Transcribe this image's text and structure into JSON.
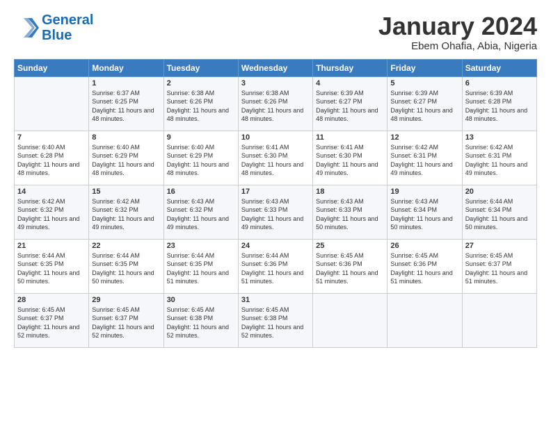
{
  "header": {
    "logo_line1": "General",
    "logo_line2": "Blue",
    "month_title": "January 2024",
    "location": "Ebem Ohafia, Abia, Nigeria"
  },
  "weekdays": [
    "Sunday",
    "Monday",
    "Tuesday",
    "Wednesday",
    "Thursday",
    "Friday",
    "Saturday"
  ],
  "weeks": [
    [
      {
        "day": "",
        "sunrise": "",
        "sunset": "",
        "daylight": ""
      },
      {
        "day": "1",
        "sunrise": "Sunrise: 6:37 AM",
        "sunset": "Sunset: 6:25 PM",
        "daylight": "Daylight: 11 hours and 48 minutes."
      },
      {
        "day": "2",
        "sunrise": "Sunrise: 6:38 AM",
        "sunset": "Sunset: 6:26 PM",
        "daylight": "Daylight: 11 hours and 48 minutes."
      },
      {
        "day": "3",
        "sunrise": "Sunrise: 6:38 AM",
        "sunset": "Sunset: 6:26 PM",
        "daylight": "Daylight: 11 hours and 48 minutes."
      },
      {
        "day": "4",
        "sunrise": "Sunrise: 6:39 AM",
        "sunset": "Sunset: 6:27 PM",
        "daylight": "Daylight: 11 hours and 48 minutes."
      },
      {
        "day": "5",
        "sunrise": "Sunrise: 6:39 AM",
        "sunset": "Sunset: 6:27 PM",
        "daylight": "Daylight: 11 hours and 48 minutes."
      },
      {
        "day": "6",
        "sunrise": "Sunrise: 6:39 AM",
        "sunset": "Sunset: 6:28 PM",
        "daylight": "Daylight: 11 hours and 48 minutes."
      }
    ],
    [
      {
        "day": "7",
        "sunrise": "Sunrise: 6:40 AM",
        "sunset": "Sunset: 6:28 PM",
        "daylight": "Daylight: 11 hours and 48 minutes."
      },
      {
        "day": "8",
        "sunrise": "Sunrise: 6:40 AM",
        "sunset": "Sunset: 6:29 PM",
        "daylight": "Daylight: 11 hours and 48 minutes."
      },
      {
        "day": "9",
        "sunrise": "Sunrise: 6:40 AM",
        "sunset": "Sunset: 6:29 PM",
        "daylight": "Daylight: 11 hours and 48 minutes."
      },
      {
        "day": "10",
        "sunrise": "Sunrise: 6:41 AM",
        "sunset": "Sunset: 6:30 PM",
        "daylight": "Daylight: 11 hours and 48 minutes."
      },
      {
        "day": "11",
        "sunrise": "Sunrise: 6:41 AM",
        "sunset": "Sunset: 6:30 PM",
        "daylight": "Daylight: 11 hours and 49 minutes."
      },
      {
        "day": "12",
        "sunrise": "Sunrise: 6:42 AM",
        "sunset": "Sunset: 6:31 PM",
        "daylight": "Daylight: 11 hours and 49 minutes."
      },
      {
        "day": "13",
        "sunrise": "Sunrise: 6:42 AM",
        "sunset": "Sunset: 6:31 PM",
        "daylight": "Daylight: 11 hours and 49 minutes."
      }
    ],
    [
      {
        "day": "14",
        "sunrise": "Sunrise: 6:42 AM",
        "sunset": "Sunset: 6:32 PM",
        "daylight": "Daylight: 11 hours and 49 minutes."
      },
      {
        "day": "15",
        "sunrise": "Sunrise: 6:42 AM",
        "sunset": "Sunset: 6:32 PM",
        "daylight": "Daylight: 11 hours and 49 minutes."
      },
      {
        "day": "16",
        "sunrise": "Sunrise: 6:43 AM",
        "sunset": "Sunset: 6:32 PM",
        "daylight": "Daylight: 11 hours and 49 minutes."
      },
      {
        "day": "17",
        "sunrise": "Sunrise: 6:43 AM",
        "sunset": "Sunset: 6:33 PM",
        "daylight": "Daylight: 11 hours and 49 minutes."
      },
      {
        "day": "18",
        "sunrise": "Sunrise: 6:43 AM",
        "sunset": "Sunset: 6:33 PM",
        "daylight": "Daylight: 11 hours and 50 minutes."
      },
      {
        "day": "19",
        "sunrise": "Sunrise: 6:43 AM",
        "sunset": "Sunset: 6:34 PM",
        "daylight": "Daylight: 11 hours and 50 minutes."
      },
      {
        "day": "20",
        "sunrise": "Sunrise: 6:44 AM",
        "sunset": "Sunset: 6:34 PM",
        "daylight": "Daylight: 11 hours and 50 minutes."
      }
    ],
    [
      {
        "day": "21",
        "sunrise": "Sunrise: 6:44 AM",
        "sunset": "Sunset: 6:35 PM",
        "daylight": "Daylight: 11 hours and 50 minutes."
      },
      {
        "day": "22",
        "sunrise": "Sunrise: 6:44 AM",
        "sunset": "Sunset: 6:35 PM",
        "daylight": "Daylight: 11 hours and 50 minutes."
      },
      {
        "day": "23",
        "sunrise": "Sunrise: 6:44 AM",
        "sunset": "Sunset: 6:35 PM",
        "daylight": "Daylight: 11 hours and 51 minutes."
      },
      {
        "day": "24",
        "sunrise": "Sunrise: 6:44 AM",
        "sunset": "Sunset: 6:36 PM",
        "daylight": "Daylight: 11 hours and 51 minutes."
      },
      {
        "day": "25",
        "sunrise": "Sunrise: 6:45 AM",
        "sunset": "Sunset: 6:36 PM",
        "daylight": "Daylight: 11 hours and 51 minutes."
      },
      {
        "day": "26",
        "sunrise": "Sunrise: 6:45 AM",
        "sunset": "Sunset: 6:36 PM",
        "daylight": "Daylight: 11 hours and 51 minutes."
      },
      {
        "day": "27",
        "sunrise": "Sunrise: 6:45 AM",
        "sunset": "Sunset: 6:37 PM",
        "daylight": "Daylight: 11 hours and 51 minutes."
      }
    ],
    [
      {
        "day": "28",
        "sunrise": "Sunrise: 6:45 AM",
        "sunset": "Sunset: 6:37 PM",
        "daylight": "Daylight: 11 hours and 52 minutes."
      },
      {
        "day": "29",
        "sunrise": "Sunrise: 6:45 AM",
        "sunset": "Sunset: 6:37 PM",
        "daylight": "Daylight: 11 hours and 52 minutes."
      },
      {
        "day": "30",
        "sunrise": "Sunrise: 6:45 AM",
        "sunset": "Sunset: 6:38 PM",
        "daylight": "Daylight: 11 hours and 52 minutes."
      },
      {
        "day": "31",
        "sunrise": "Sunrise: 6:45 AM",
        "sunset": "Sunset: 6:38 PM",
        "daylight": "Daylight: 11 hours and 52 minutes."
      },
      {
        "day": "",
        "sunrise": "",
        "sunset": "",
        "daylight": ""
      },
      {
        "day": "",
        "sunrise": "",
        "sunset": "",
        "daylight": ""
      },
      {
        "day": "",
        "sunrise": "",
        "sunset": "",
        "daylight": ""
      }
    ]
  ]
}
